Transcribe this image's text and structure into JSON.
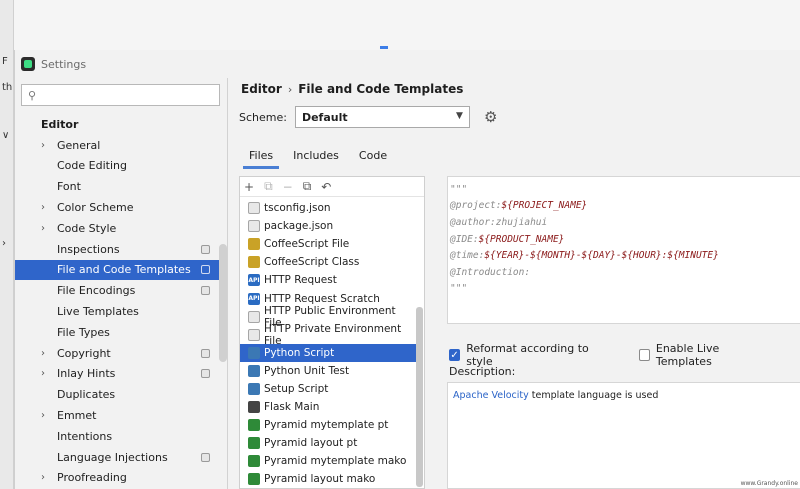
{
  "window": {
    "title": "Settings"
  },
  "ide": {
    "glyphs": [
      "F",
      "th",
      "∨",
      "›"
    ]
  },
  "search": {
    "placeholder": ""
  },
  "tree": {
    "header": "Editor",
    "items": [
      {
        "label": "General",
        "expandable": true
      },
      {
        "label": "Code Editing",
        "expandable": false
      },
      {
        "label": "Font",
        "expandable": false
      },
      {
        "label": "Color Scheme",
        "expandable": true
      },
      {
        "label": "Code Style",
        "expandable": true
      },
      {
        "label": "Inspections",
        "expandable": false,
        "badge": true
      },
      {
        "label": "File and Code Templates",
        "expandable": false,
        "badge": true,
        "selected": true
      },
      {
        "label": "File Encodings",
        "expandable": false,
        "badge": true
      },
      {
        "label": "Live Templates",
        "expandable": false
      },
      {
        "label": "File Types",
        "expandable": false
      },
      {
        "label": "Copyright",
        "expandable": true,
        "badge": true
      },
      {
        "label": "Inlay Hints",
        "expandable": true,
        "badge": true
      },
      {
        "label": "Duplicates",
        "expandable": false
      },
      {
        "label": "Emmet",
        "expandable": true
      },
      {
        "label": "Intentions",
        "expandable": false
      },
      {
        "label": "Language Injections",
        "expandable": false,
        "badge": true
      },
      {
        "label": "Proofreading",
        "expandable": true
      }
    ]
  },
  "breadcrumb": {
    "parent": "Editor",
    "separator": "›",
    "current": "File and Code Templates"
  },
  "scheme": {
    "label": "Scheme:",
    "value": "Default"
  },
  "tabs": [
    {
      "label": "Files",
      "active": true
    },
    {
      "label": "Includes",
      "active": false
    },
    {
      "label": "Code",
      "active": false
    }
  ],
  "toolbar": {
    "add": "+",
    "copy": "⧉",
    "remove": "−",
    "duplicate": "⧉",
    "reset": "↶"
  },
  "files": [
    {
      "name": "tsconfig.json",
      "icon": "doc"
    },
    {
      "name": "package.json",
      "icon": "doc"
    },
    {
      "name": "CoffeeScript File",
      "icon": "cs"
    },
    {
      "name": "CoffeeScript Class",
      "icon": "cs"
    },
    {
      "name": "HTTP Request",
      "icon": "api"
    },
    {
      "name": "HTTP Request Scratch",
      "icon": "api"
    },
    {
      "name": "HTTP Public Environment File",
      "icon": "doc"
    },
    {
      "name": "HTTP Private Environment File",
      "icon": "doc"
    },
    {
      "name": "Python Script",
      "icon": "py",
      "selected": true
    },
    {
      "name": "Python Unit Test",
      "icon": "py"
    },
    {
      "name": "Setup Script",
      "icon": "py"
    },
    {
      "name": "Flask Main",
      "icon": "flask"
    },
    {
      "name": "Pyramid mytemplate pt",
      "icon": "pyramid"
    },
    {
      "name": "Pyramid layout pt",
      "icon": "pyramid"
    },
    {
      "name": "Pyramid mytemplate mako",
      "icon": "pyramid"
    },
    {
      "name": "Pyramid layout mako",
      "icon": "pyramid"
    }
  ],
  "editor": {
    "lines": [
      {
        "key": "\"\"\"",
        "value": ""
      },
      {
        "key": "@project:",
        "value": "${PROJECT_NAME}"
      },
      {
        "key": "@author:zhujiahui",
        "value": ""
      },
      {
        "key": "@IDE:",
        "value": "${PRODUCT_NAME}"
      },
      {
        "key": "@time:",
        "value": "${YEAR}-${MONTH}-${DAY}-${HOUR}:${MINUTE}"
      },
      {
        "key": "@Introduction:",
        "value": ""
      },
      {
        "key": "\"\"\"",
        "value": ""
      }
    ]
  },
  "options": {
    "reformat": {
      "label": "Reformat according to style",
      "checked": true
    },
    "live_templates": {
      "label": "Enable Live Templates",
      "checked": false
    }
  },
  "description": {
    "label": "Description:",
    "link": "Apache Velocity",
    "text": " template language is used"
  },
  "watermark": "www.Grandy.online",
  "colors": {
    "accent": "#2f65ca",
    "template_var": "#8b1a1a",
    "link": "#2a63c7"
  }
}
